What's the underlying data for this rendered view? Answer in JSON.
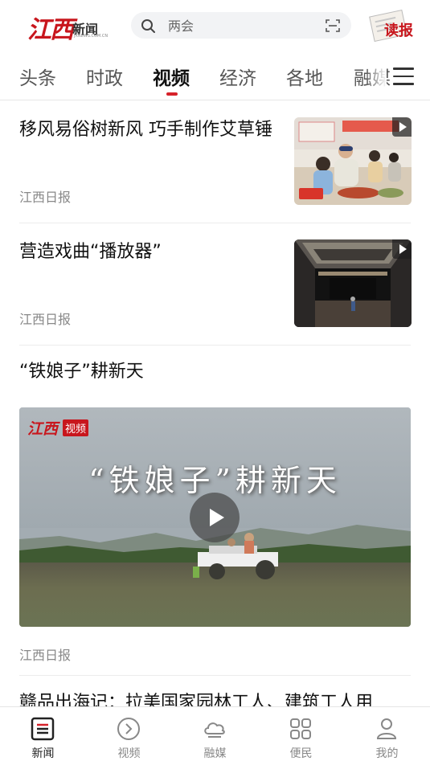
{
  "header": {
    "logo_text": "江西",
    "logo_sub": "新闻",
    "logo_domain": "JXNEWS.COM.CN",
    "search_placeholder": "两会",
    "read_label": "读报"
  },
  "tabs": [
    "头条",
    "时政",
    "视频",
    "经济",
    "各地",
    "融媒"
  ],
  "active_tab": "视频",
  "feed": {
    "items": [
      {
        "title": "移风易俗树新风 巧手制作艾草锤",
        "source": "江西日报"
      },
      {
        "title": "营造戏曲“播放器”",
        "source": "江西日报"
      }
    ],
    "feature": {
      "title": "“铁娘子”耕新天",
      "video_overlay_title": "“铁娘子”耕新天",
      "watermark_logo": "江西",
      "watermark_tag": "视频",
      "source": "江西日报"
    },
    "next_title": "赣品出海记：拉美国家园林工人、建筑工人用"
  },
  "bottom_nav": [
    {
      "label": "新闻",
      "icon": "news-icon"
    },
    {
      "label": "视频",
      "icon": "video-icon"
    },
    {
      "label": "融媒",
      "icon": "cloud-icon"
    },
    {
      "label": "便民",
      "icon": "grid-icon"
    },
    {
      "label": "我的",
      "icon": "person-icon"
    }
  ],
  "colors": {
    "accent": "#d6222a",
    "brand_red": "#c8161d"
  }
}
